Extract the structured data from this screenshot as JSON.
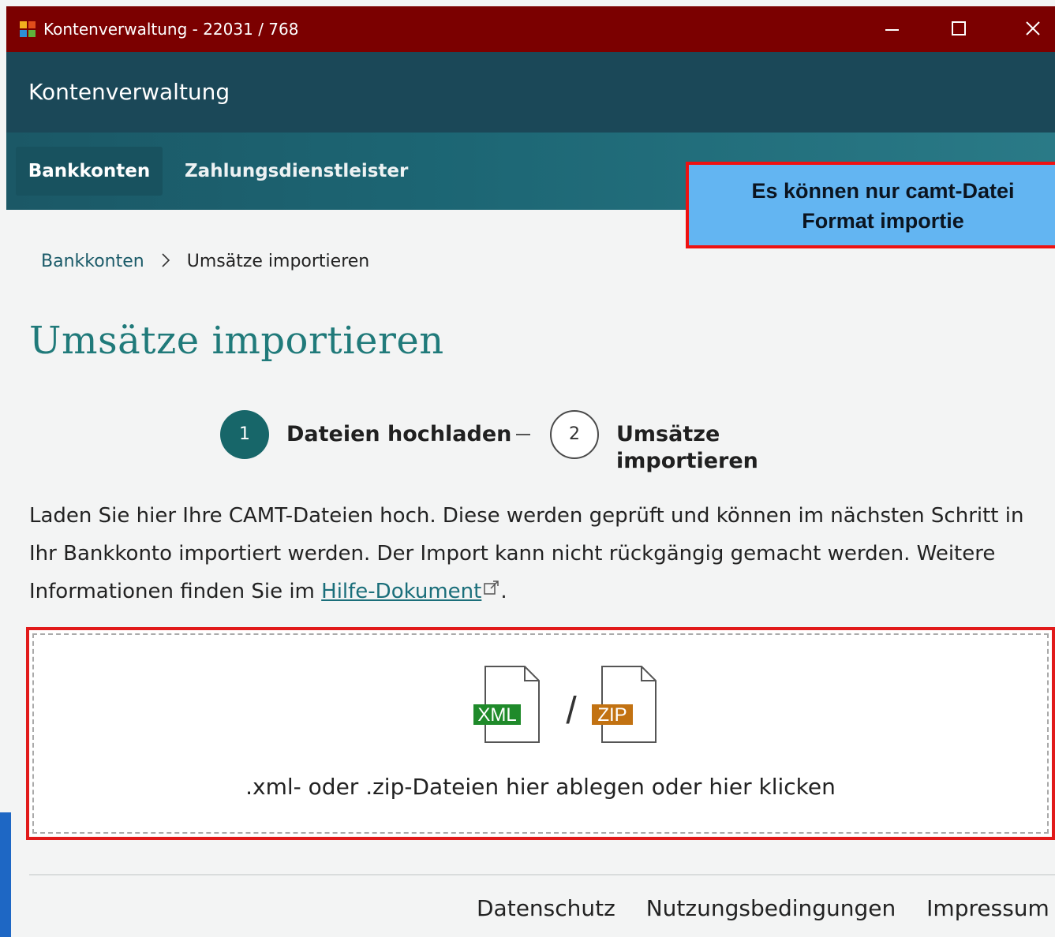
{
  "window": {
    "title": "Kontenverwaltung - 22031 / 768",
    "controls": [
      "minimize",
      "maximize",
      "close"
    ]
  },
  "app": {
    "name": "Kontenverwaltung"
  },
  "nav": {
    "tabs": [
      {
        "label": "Bankkonten",
        "active": true
      },
      {
        "label": "Zahlungsdienstleister",
        "active": false
      }
    ]
  },
  "callout": {
    "line1": "Es können nur camt-Datei",
    "line2": "Format importie"
  },
  "breadcrumb": {
    "link": "Bankkonten",
    "separator": "›",
    "current": "Umsätze importieren"
  },
  "page": {
    "title": "Umsätze importieren"
  },
  "stepper": {
    "steps": [
      {
        "number": "1",
        "label": "Dateien hochladen",
        "active": true
      },
      {
        "number": "2",
        "label": "Umsätze importieren",
        "active": false
      }
    ]
  },
  "intro": {
    "text": "Laden Sie hier Ihre CAMT-Dateien hoch. Diese werden geprüft und können im nächsten Schritt in Ihr Bankkonto importiert werden. Der Import kann nicht rückgängig gemacht werden. Weitere Informationen finden Sie im ",
    "link": "Hilfe-Dokument",
    "end": "."
  },
  "dropzone": {
    "xml_badge": "XML",
    "separator": "/",
    "zip_badge": "ZIP",
    "text": ".xml- oder .zip-Dateien hier ablegen oder hier klicken"
  },
  "footer": {
    "links": [
      "Datenschutz",
      "Nutzungsbedingungen",
      "Impressum"
    ]
  },
  "colors": {
    "titlebar": "#7b0000",
    "appbar": "#1b4858",
    "nav": "#1c6573",
    "accent": "#176669",
    "callout_bg": "#63b5f2",
    "highlight_border": "#ee1111",
    "xml_badge": "#1f8a2a",
    "zip_badge": "#c27212"
  }
}
